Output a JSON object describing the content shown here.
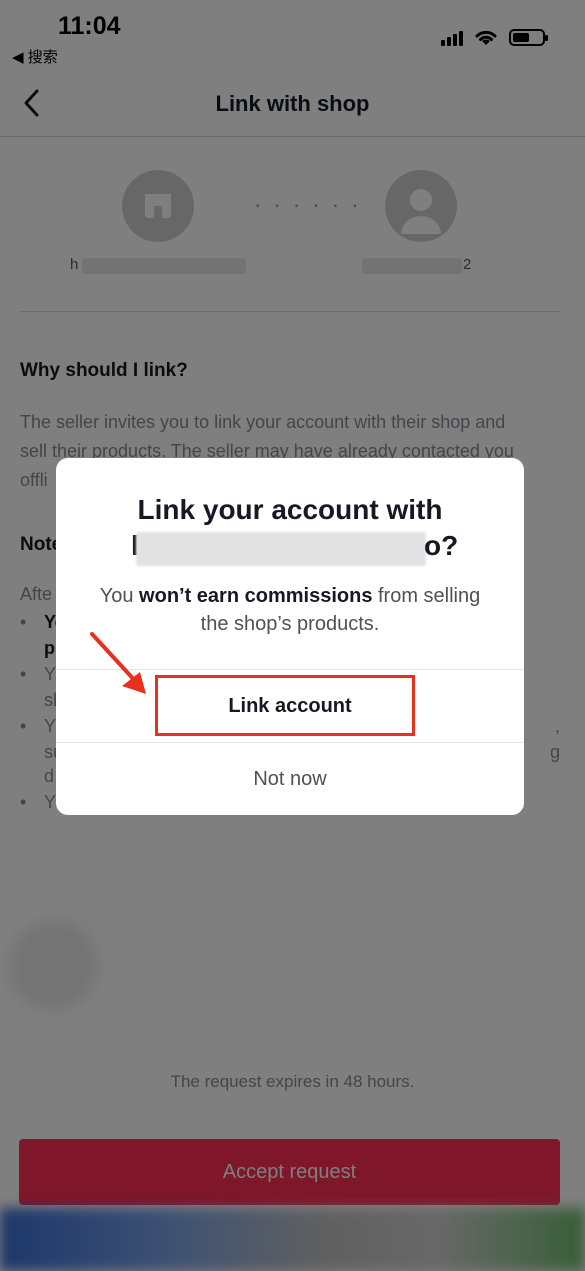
{
  "status_bar": {
    "time": "11:04",
    "back_label": "◀ 搜索"
  },
  "nav": {
    "title": "Link with shop"
  },
  "profiles": {
    "shop_name_visible": "h",
    "user_name_visible": "2"
  },
  "why": {
    "title": "Why should I link?",
    "body_line1": "The seller invites you to link your account with their shop and",
    "body_line2": "sell their products. The seller may have already contacted you",
    "body_line3": "offli"
  },
  "notes": {
    "title": "Note",
    "after": "Afte",
    "bullets": [
      {
        "a": "Yo",
        "b": "p",
        "bold": true
      },
      {
        "a": "Y",
        "b": "sh",
        "bold": false
      },
      {
        "a": "Y",
        "b": "su",
        "c": "d",
        "bold": false
      },
      {
        "a": "Y",
        "bold": false
      }
    ],
    "right_frag_1": ",",
    "right_frag_2": "g"
  },
  "expire_text": "The request expires in 48 hours.",
  "accept_label": "Accept request",
  "modal": {
    "title_line1": "Link your account with",
    "title_lead": "l",
    "title_tail": "o?",
    "desc_pre": "You ",
    "desc_bold": "won’t earn commissions",
    "desc_post": " from selling the shop’s products.",
    "link_label": "Link account",
    "notnow_label": "Not now"
  },
  "colors": {
    "accent": "#fe2c55",
    "annotation": "#e8301c"
  }
}
